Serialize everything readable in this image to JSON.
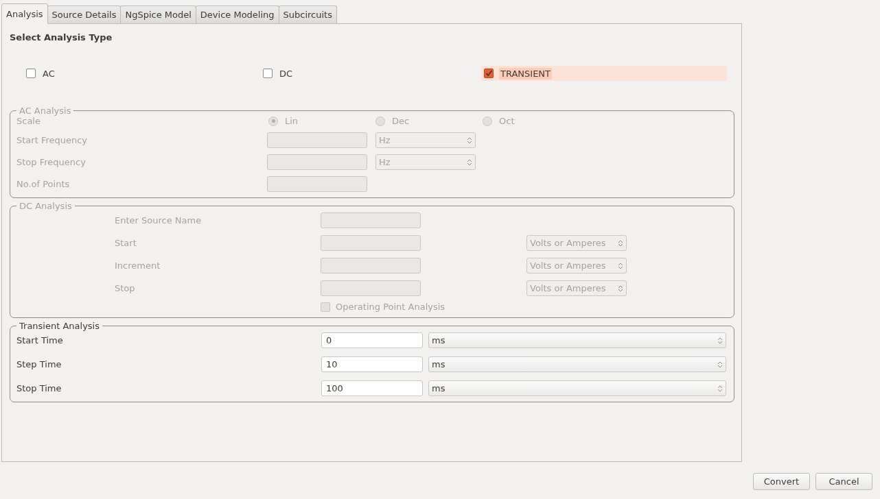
{
  "tabs": [
    {
      "label": "Analysis",
      "selected": true
    },
    {
      "label": "Source Details",
      "selected": false
    },
    {
      "label": "NgSpice Model",
      "selected": false
    },
    {
      "label": "Device Modeling",
      "selected": false
    },
    {
      "label": "Subcircuits",
      "selected": false
    }
  ],
  "heading": "Select Analysis Type",
  "analysis_types": [
    {
      "label": "AC",
      "checked": false,
      "highlighted": false
    },
    {
      "label": "DC",
      "checked": false,
      "highlighted": false
    },
    {
      "label": "TRANSIENT",
      "checked": true,
      "highlighted": true
    }
  ],
  "ac_analysis": {
    "title": "AC Analysis",
    "disabled": true,
    "scale": {
      "label": "Scale",
      "options": [
        {
          "label": "Lin",
          "selected": true
        },
        {
          "label": "Dec",
          "selected": false
        },
        {
          "label": "Oct",
          "selected": false
        }
      ]
    },
    "rows": [
      {
        "label": "Start Frequency",
        "unit": "Hz"
      },
      {
        "label": "Stop Frequency",
        "unit": "Hz"
      },
      {
        "label": "No.of Points"
      }
    ]
  },
  "dc_analysis": {
    "title": "DC Analysis",
    "disabled": true,
    "rows": [
      {
        "label": "Enter Source Name"
      },
      {
        "label": "Start",
        "unit": "Volts or Amperes"
      },
      {
        "label": "Increment",
        "unit": "Volts or Amperes"
      },
      {
        "label": "Stop",
        "unit": "Volts or Amperes"
      }
    ],
    "operating_point": {
      "label": "Operating Point Analysis",
      "checked": false
    }
  },
  "transient_analysis": {
    "title": "Transient Analysis",
    "disabled": false,
    "rows": [
      {
        "label": "Start Time",
        "value": "0",
        "unit": "ms"
      },
      {
        "label": "Step Time",
        "value": "10",
        "unit": "ms"
      },
      {
        "label": "Stop Time",
        "value": "100",
        "unit": "ms"
      }
    ]
  },
  "buttons": [
    "Convert",
    "Cancel"
  ]
}
